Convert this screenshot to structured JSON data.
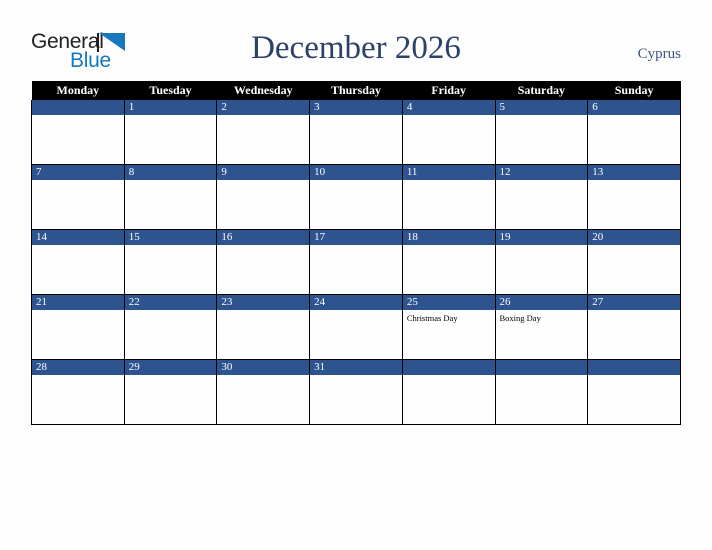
{
  "brand": {
    "name_part1": "General",
    "name_part2": "Blue",
    "triangle_icon": "triangle-icon",
    "color_dark": "#231f20",
    "color_blue": "#1878be"
  },
  "header": {
    "title": "December 2026",
    "country": "Cyprus",
    "title_color": "#2c4169"
  },
  "calendar": {
    "weekday_headers": [
      "Monday",
      "Tuesday",
      "Wednesday",
      "Thursday",
      "Friday",
      "Saturday",
      "Sunday"
    ],
    "header_bg": "#000000",
    "date_bar_bg": "#2e5490",
    "weeks": [
      [
        {
          "day": "",
          "events": []
        },
        {
          "day": "1",
          "events": []
        },
        {
          "day": "2",
          "events": []
        },
        {
          "day": "3",
          "events": []
        },
        {
          "day": "4",
          "events": []
        },
        {
          "day": "5",
          "events": []
        },
        {
          "day": "6",
          "events": []
        }
      ],
      [
        {
          "day": "7",
          "events": []
        },
        {
          "day": "8",
          "events": []
        },
        {
          "day": "9",
          "events": []
        },
        {
          "day": "10",
          "events": []
        },
        {
          "day": "11",
          "events": []
        },
        {
          "day": "12",
          "events": []
        },
        {
          "day": "13",
          "events": []
        }
      ],
      [
        {
          "day": "14",
          "events": []
        },
        {
          "day": "15",
          "events": []
        },
        {
          "day": "16",
          "events": []
        },
        {
          "day": "17",
          "events": []
        },
        {
          "day": "18",
          "events": []
        },
        {
          "day": "19",
          "events": []
        },
        {
          "day": "20",
          "events": []
        }
      ],
      [
        {
          "day": "21",
          "events": []
        },
        {
          "day": "22",
          "events": []
        },
        {
          "day": "23",
          "events": []
        },
        {
          "day": "24",
          "events": []
        },
        {
          "day": "25",
          "events": [
            "Christmas Day"
          ]
        },
        {
          "day": "26",
          "events": [
            "Boxing Day"
          ]
        },
        {
          "day": "27",
          "events": []
        }
      ],
      [
        {
          "day": "28",
          "events": []
        },
        {
          "day": "29",
          "events": []
        },
        {
          "day": "30",
          "events": []
        },
        {
          "day": "31",
          "events": []
        },
        {
          "day": "",
          "events": []
        },
        {
          "day": "",
          "events": []
        },
        {
          "day": "",
          "events": []
        }
      ]
    ]
  }
}
